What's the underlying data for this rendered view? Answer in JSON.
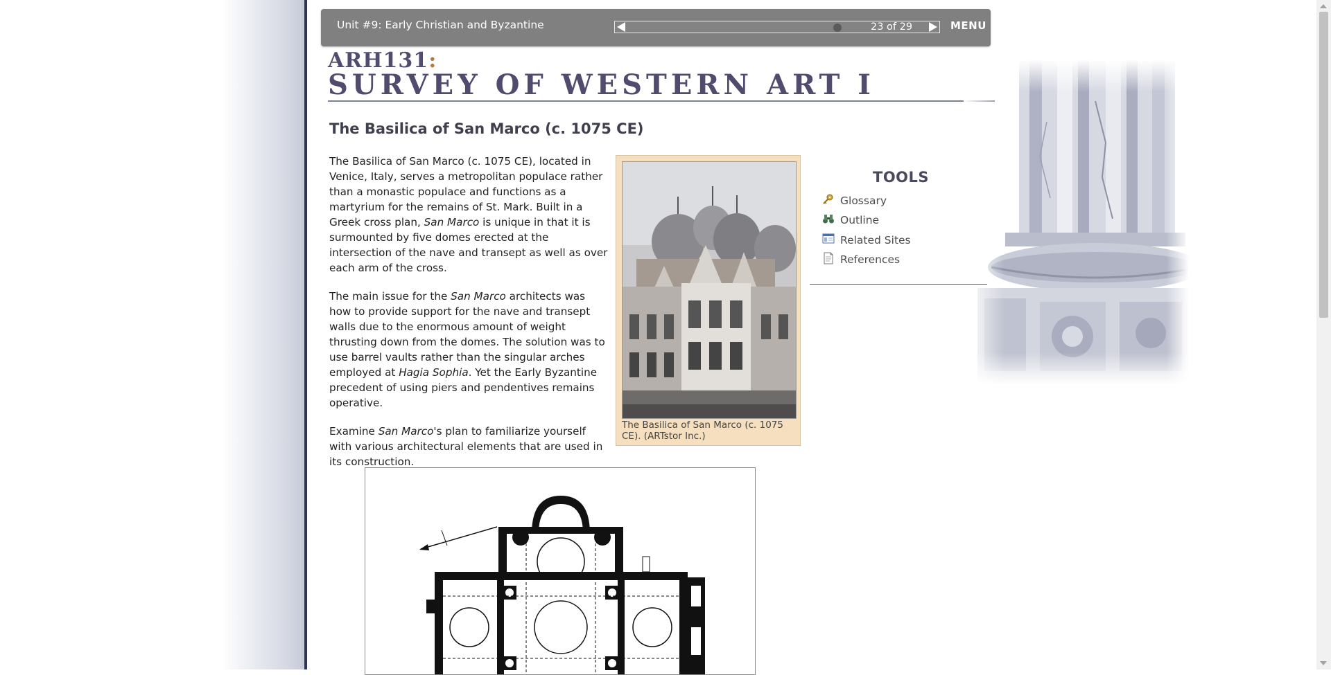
{
  "nav": {
    "unit_title": "Unit #9: Early Christian and Byzantine",
    "page_indicator": "23 of 29",
    "page_current": 23,
    "page_total": 29,
    "menu_label": "MENU"
  },
  "header": {
    "course_code": "ARH131",
    "course_code_suffix": ":",
    "course_name": "SURVEY OF WESTERN ART I"
  },
  "page_title": "The Basilica of San Marco (c. 1075 CE)",
  "body": {
    "p1": [
      "The Basilica of San Marco (c. 1075 CE), located in Venice, Italy, serves a metropolitan populace rather than a monastic populace and functions as a martyrium for the remains of St. Mark. Built in a Greek cross plan, ",
      "San Marco",
      " is unique in that it is surmounted by five domes erected at the intersection of the nave and transept as well as over each arm of the cross."
    ],
    "p2": [
      "The main issue for the ",
      "San Marco",
      " architects was how to provide support for the nave and transept walls due to the enormous amount of weight thrusting down from the domes. The solution was to use barrel vaults rather than the singular arches employed at ",
      "Hagia Sophia",
      ". Yet the Early Byzantine precedent of using piers and pendentives remains operative."
    ],
    "p3": [
      "Examine ",
      "San Marco",
      "'s plan to familiarize yourself with various architectural elements that are used in its construction."
    ]
  },
  "figure": {
    "caption": "The Basilica of San Marco (c. 1075 CE). (ARTstor Inc.)"
  },
  "tools": {
    "title": "TOOLS",
    "items": [
      {
        "label": "Glossary",
        "icon": "key-icon"
      },
      {
        "label": "Outline",
        "icon": "binoculars-icon"
      },
      {
        "label": "Related Sites",
        "icon": "browser-window-icon"
      },
      {
        "label": "References",
        "icon": "document-icon"
      }
    ]
  },
  "colors": {
    "nav_bar": "#808080",
    "heading_purple": "#514b6e",
    "caption_bg": "#f5dfbf",
    "left_border": "#2e3556"
  }
}
